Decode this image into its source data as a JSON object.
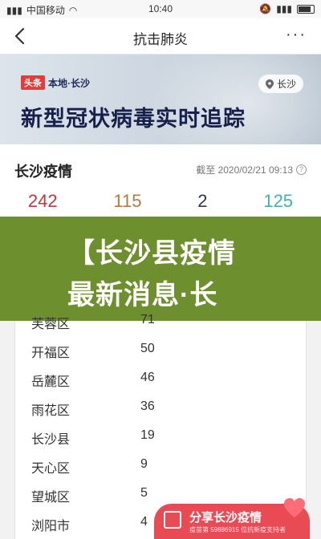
{
  "status_bar": {
    "carrier": "中国移动",
    "time": "10:40",
    "battery_icon": "battery-icon"
  },
  "nav": {
    "title": "抗击肺炎",
    "back_icon": "back-icon",
    "more": "···"
  },
  "banner": {
    "tag_red": "头条",
    "tag_text": "本地·长沙",
    "location_pill": "长沙",
    "title": "新型冠状病毒实时追踪"
  },
  "stats": {
    "city_title": "长沙疫情",
    "as_of": "截至 2020/02/21 09:13",
    "numbers": [
      "242",
      "115",
      "2",
      "125"
    ],
    "colors": [
      "#c2363d",
      "#c0763a",
      "#2d3a4a",
      "#3eb4b0"
    ]
  },
  "overlay": {
    "line1": "【长沙县疫情",
    "line2": "最新消息·长",
    "background": "#6e8f2d"
  },
  "districts": [
    {
      "name": "芙蓉区",
      "count": "71"
    },
    {
      "name": "开福区",
      "count": "50"
    },
    {
      "name": "岳麓区",
      "count": "46"
    },
    {
      "name": "雨花区",
      "count": "36"
    },
    {
      "name": "长沙县",
      "count": "19"
    },
    {
      "name": "天心区",
      "count": "9"
    },
    {
      "name": "望城区",
      "count": "5"
    },
    {
      "name": "浏阳市",
      "count": "4"
    }
  ],
  "share": {
    "label": "分享长沙疫情",
    "sub": "疫苗第 59886915 位抗新疫支持者"
  }
}
